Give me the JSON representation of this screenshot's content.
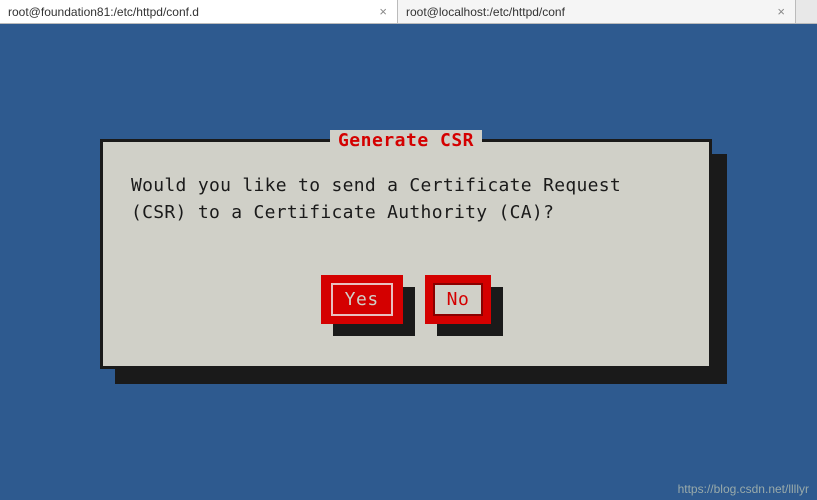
{
  "tabs": [
    {
      "label": "root@foundation81:/etc/httpd/conf.d",
      "active": true
    },
    {
      "label": "root@localhost:/etc/httpd/conf",
      "active": false
    }
  ],
  "dialog": {
    "title": "Generate CSR",
    "message": "Would you like to send a Certificate Request (CSR) to a Certificate Authority (CA)?",
    "yes_label": "Yes",
    "no_label": "No"
  },
  "watermark": "https://blog.csdn.net/llllyr",
  "colors": {
    "terminal_bg": "#2e5a8f",
    "dialog_bg": "#d0d0c8",
    "accent_red": "#d40000"
  }
}
